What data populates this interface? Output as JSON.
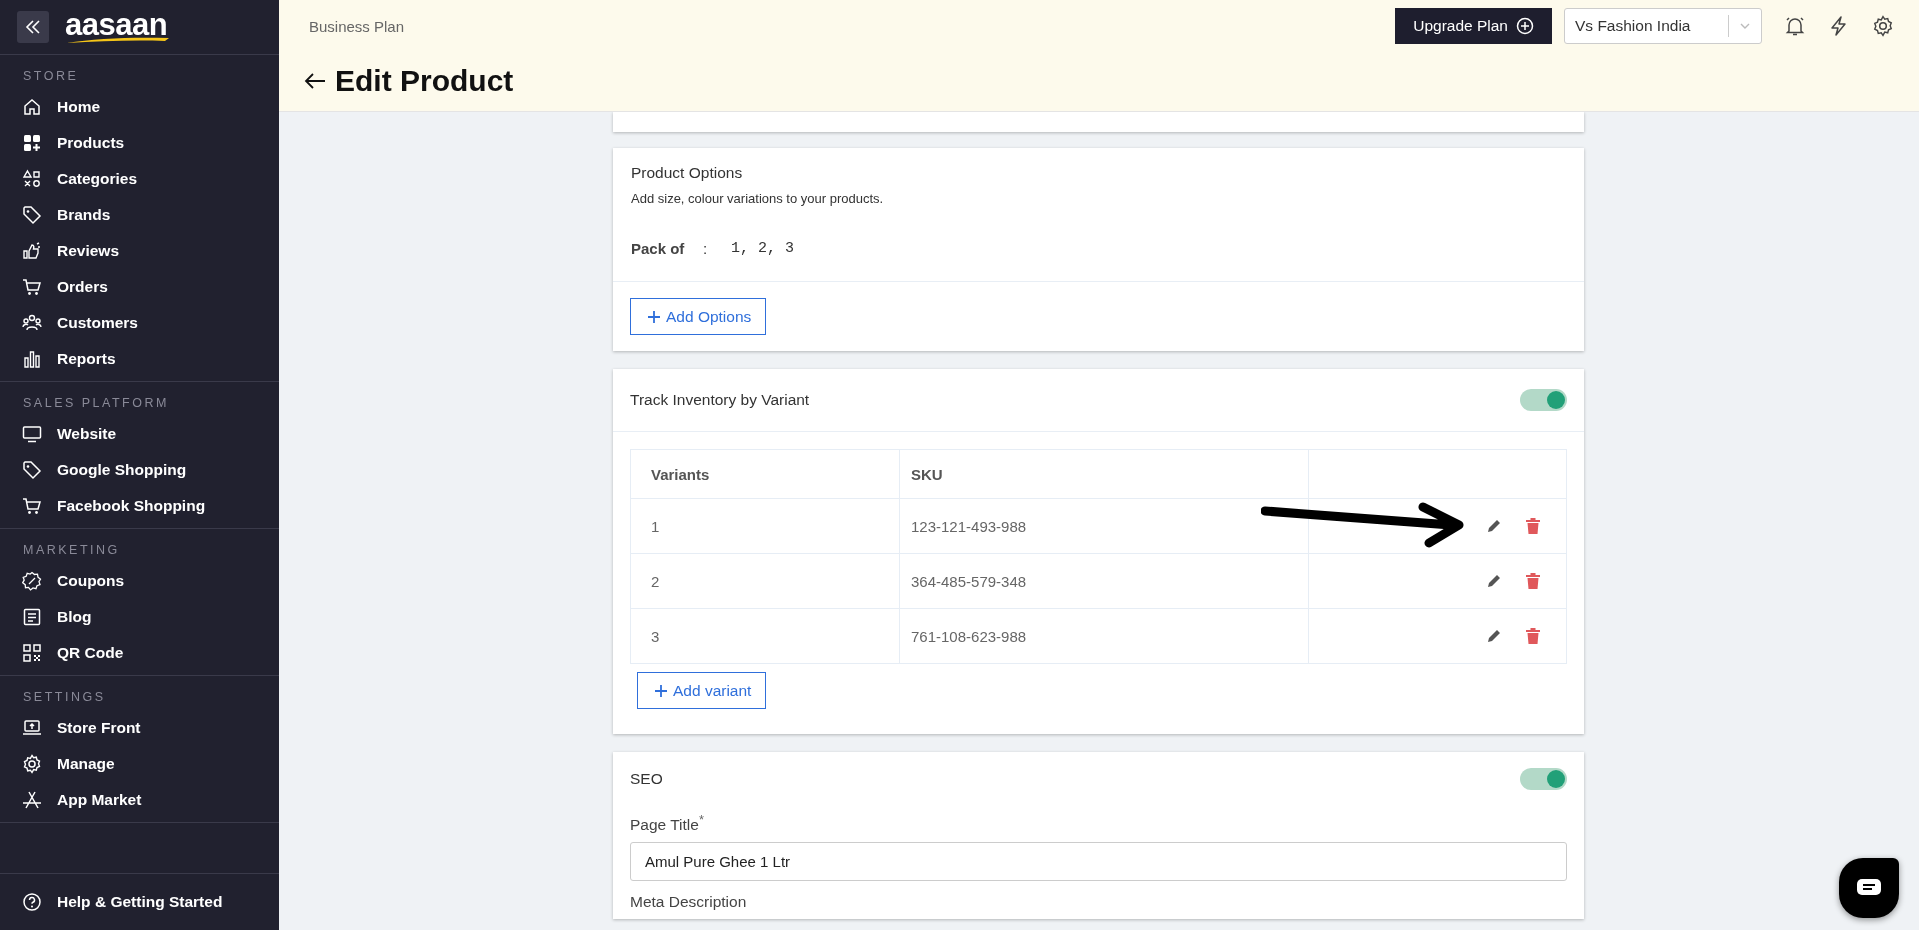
{
  "sidebar": {
    "logo": "aasaan",
    "sections": [
      {
        "title": "STORE",
        "items": [
          {
            "label": "Home"
          },
          {
            "label": "Products"
          },
          {
            "label": "Categories"
          },
          {
            "label": "Brands"
          },
          {
            "label": "Reviews"
          },
          {
            "label": "Orders"
          },
          {
            "label": "Customers"
          },
          {
            "label": "Reports"
          }
        ]
      },
      {
        "title": "SALES PLATFORM",
        "items": [
          {
            "label": "Website"
          },
          {
            "label": "Google Shopping"
          },
          {
            "label": "Facebook Shopping"
          }
        ]
      },
      {
        "title": "MARKETING",
        "items": [
          {
            "label": "Coupons"
          },
          {
            "label": "Blog"
          },
          {
            "label": "QR Code"
          }
        ]
      },
      {
        "title": "SETTINGS",
        "items": [
          {
            "label": "Store Front"
          },
          {
            "label": "Manage"
          },
          {
            "label": "App Market"
          }
        ]
      }
    ],
    "help": "Help & Getting Started"
  },
  "header": {
    "plan": "Business Plan",
    "upgrade_button": "Upgrade Plan",
    "store_select": "Vs Fashion India",
    "page_title": "Edit Product"
  },
  "product_options": {
    "title": "Product Options",
    "description": "Add size, colour variations to your products.",
    "options": [
      {
        "name": "Pack of",
        "separator": ":",
        "values": "1, 2, 3"
      }
    ],
    "add_button": "Add Options"
  },
  "track_inventory": {
    "title": "Track Inventory by Variant",
    "on": true,
    "columns": [
      "Variants",
      "SKU"
    ],
    "rows": [
      {
        "variant": "1",
        "sku": "123-121-493-988"
      },
      {
        "variant": "2",
        "sku": "364-485-579-348"
      },
      {
        "variant": "3",
        "sku": "761-108-623-988"
      }
    ],
    "add_button": "Add variant"
  },
  "seo": {
    "title": "SEO",
    "on": true,
    "page_title_label": "Page Title",
    "required_mark": "*",
    "page_title_value": "Amul Pure Ghee 1 Ltr",
    "meta_label": "Meta Description"
  }
}
